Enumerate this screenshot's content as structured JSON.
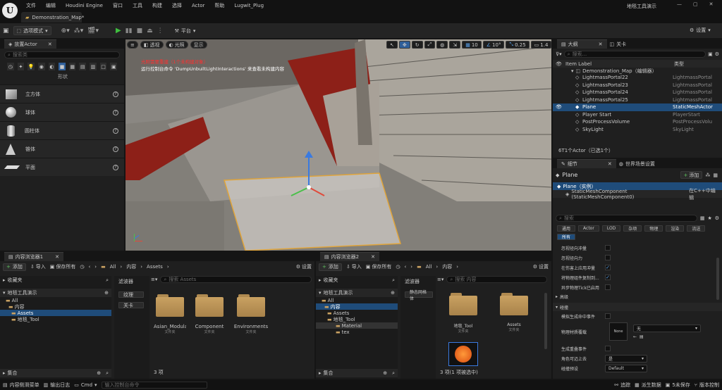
{
  "menu": {
    "items": [
      "文件",
      "编辑",
      "Houdini Engine",
      "窗口",
      "工具",
      "构建",
      "选择",
      "Actor",
      "帮助",
      "Lugwit_Plug"
    ],
    "project_title": "地毯工具演示",
    "map_tab": "Demonstration_Map*"
  },
  "toolbar": {
    "mode_label": "选项模式",
    "platform_label": "平台",
    "settings_label": "设置"
  },
  "place_actor": {
    "tab": "放置Actor",
    "search_placeholder": "搜索类",
    "category_label": "形状",
    "items": [
      "立方体",
      "球体",
      "圆柱体",
      "锥体",
      "平面"
    ]
  },
  "viewport": {
    "perspective": "透视",
    "lit": "光照",
    "show": "显示",
    "grid_snap": "10",
    "rot_snap": "10°",
    "scale_snap": "0.25",
    "cam_speed": "1.4",
    "warning_red": "光照需要重建（1个未构建对象）",
    "warning_white": "运行控制台命令 'DumpUnbuiltLightInteractions' 来查看未构建内容"
  },
  "outliner": {
    "tab": "大纲",
    "tab2": "关卡",
    "search_placeholder": "搜索...",
    "col_label": "Item Label",
    "col_type": "类型",
    "root": "Demonstration_Map（编辑器）",
    "rows": [
      {
        "label": "LightmassPortal22",
        "type": "LightmassPortal"
      },
      {
        "label": "LightmassPortal23",
        "type": "LightmassPortal"
      },
      {
        "label": "LightmassPortal24",
        "type": "LightmassPortal"
      },
      {
        "label": "LightmassPortal25",
        "type": "LightmassPortal"
      },
      {
        "label": "Plane",
        "type": "StaticMeshActor"
      },
      {
        "label": "Player Start",
        "type": "PlayerStart"
      },
      {
        "label": "PostProcessVolume",
        "type": "PostProcessVolu"
      },
      {
        "label": "SkyLight",
        "type": "SkyLight"
      }
    ],
    "footer": "6T1个Actor（已选1个）"
  },
  "details": {
    "tab": "细节",
    "tab2": "世界场景设置",
    "name": "Plane",
    "add_label": "添加",
    "instance": "Plane（实例）",
    "component": "StaticMeshComponent (StaticMeshComponent0)",
    "edit_cpp": "在C++中编辑",
    "search_placeholder": "搜索",
    "filters": [
      "通用",
      "Actor",
      "LOD",
      "杂项",
      "物理",
      "渲染",
      "流送"
    ],
    "all_filter": "所有",
    "props": [
      {
        "label": "忽视径向冲量",
        "checked": false
      },
      {
        "label": "忽视径向力",
        "checked": false
      },
      {
        "label": "在伤害上应用冲量",
        "checked": true
      },
      {
        "label": "将物理组件复制到...",
        "checked": true
      },
      {
        "label": "异步物理Tick已启用",
        "checked": false
      }
    ],
    "section_advanced": "高级",
    "section_collision": "碰撞",
    "collision_props": {
      "sim_hit": "模拟生成命中事件",
      "phys_material": "物理材质覆载",
      "none_val": "无",
      "none_thumb": "None",
      "overlap": "生成重叠事件",
      "step_up": "角色可迈上去",
      "step_up_val": "是",
      "preset": "碰撞预设",
      "preset_val": "Default"
    }
  },
  "cb1": {
    "tab": "内容浏览器1",
    "add": "添加",
    "import": "导入",
    "save_all": "保存所有",
    "path": [
      "All",
      "内容",
      "Assets"
    ],
    "settings": "设置",
    "favorites": "收藏夹",
    "project": "地毯工具演示",
    "tree": [
      "All",
      "内容",
      "Assets",
      "地毯_Tool"
    ],
    "filters_label": "滤波器",
    "filter_items": [
      "纹理",
      "关卡"
    ],
    "search_placeholder": "搜索 Assets",
    "assets": [
      {
        "name": "Asian_Modular_Temple",
        "sub": "文件夹"
      },
      {
        "name": "Component",
        "sub": "文件夹"
      },
      {
        "name": "Environments",
        "sub": "文件夹"
      }
    ],
    "count": "3 项",
    "collections": "集合"
  },
  "cb2": {
    "tab": "内容浏览器2",
    "add": "添加",
    "import": "导入",
    "save_all": "保存所有",
    "path": [
      "All",
      "内容"
    ],
    "settings": "设置",
    "favorites": "收藏夹",
    "project": "地毯工具演示",
    "tree": [
      "All",
      "内容",
      "Assets",
      "地毯_Tool",
      "Material",
      "tex"
    ],
    "filters_label": "滤波器",
    "filter_items": [
      "静态网格体"
    ],
    "search_placeholder": "搜索 内容",
    "assets": [
      {
        "name": "地毯_Tool",
        "sub": "文件夹"
      },
      {
        "name": "Assets",
        "sub": "文件夹"
      }
    ],
    "count": "3 项(1 项被选中)",
    "collections": "集合"
  },
  "statusbar": {
    "content_drawer": "内容侧滑菜单",
    "output_log": "输出日志",
    "cmd": "Cmd",
    "cmd_placeholder": "输入控制台命令",
    "trace": "追踪",
    "derived": "派生数据",
    "unsaved": "5未保存",
    "source_control": "版本控制"
  }
}
